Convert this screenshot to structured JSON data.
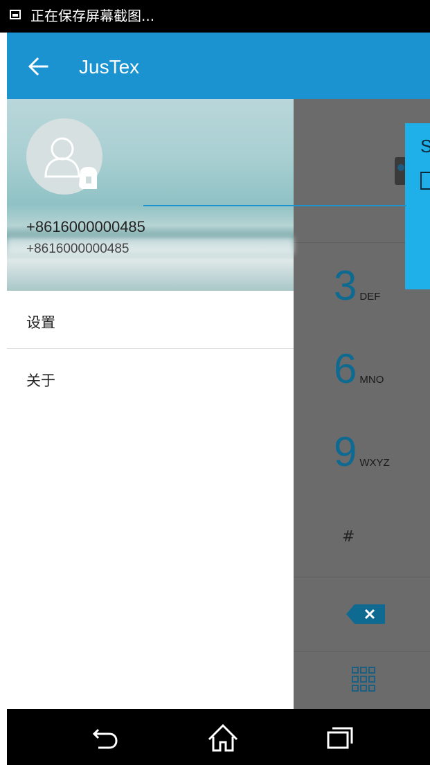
{
  "status_bar": {
    "notification_text": "正在保存屏幕截图...",
    "icon": "image-icon"
  },
  "app_bar": {
    "title": "JusTex",
    "back_icon": "arrow-left-icon",
    "color": "#1a93d0"
  },
  "drawer": {
    "user_name": "+8616000000485",
    "user_number": "+8616000000485",
    "avatar_icon": "person-icon",
    "menu": [
      {
        "label": "设置"
      },
      {
        "label": "关于"
      }
    ]
  },
  "dialer": {
    "keys": [
      {
        "digit": "3",
        "letters": "DEF"
      },
      {
        "digit": "6",
        "letters": "MNO"
      },
      {
        "digit": "9",
        "letters": "WXYZ"
      }
    ],
    "hash": "#",
    "delete_icon": "backspace-icon",
    "keypad_icon": "dialpad-icon"
  },
  "popup": {
    "visible_text": "S"
  },
  "nav_bar": {
    "back_icon": "back-icon",
    "home_icon": "home-icon",
    "recents_icon": "recents-icon"
  }
}
